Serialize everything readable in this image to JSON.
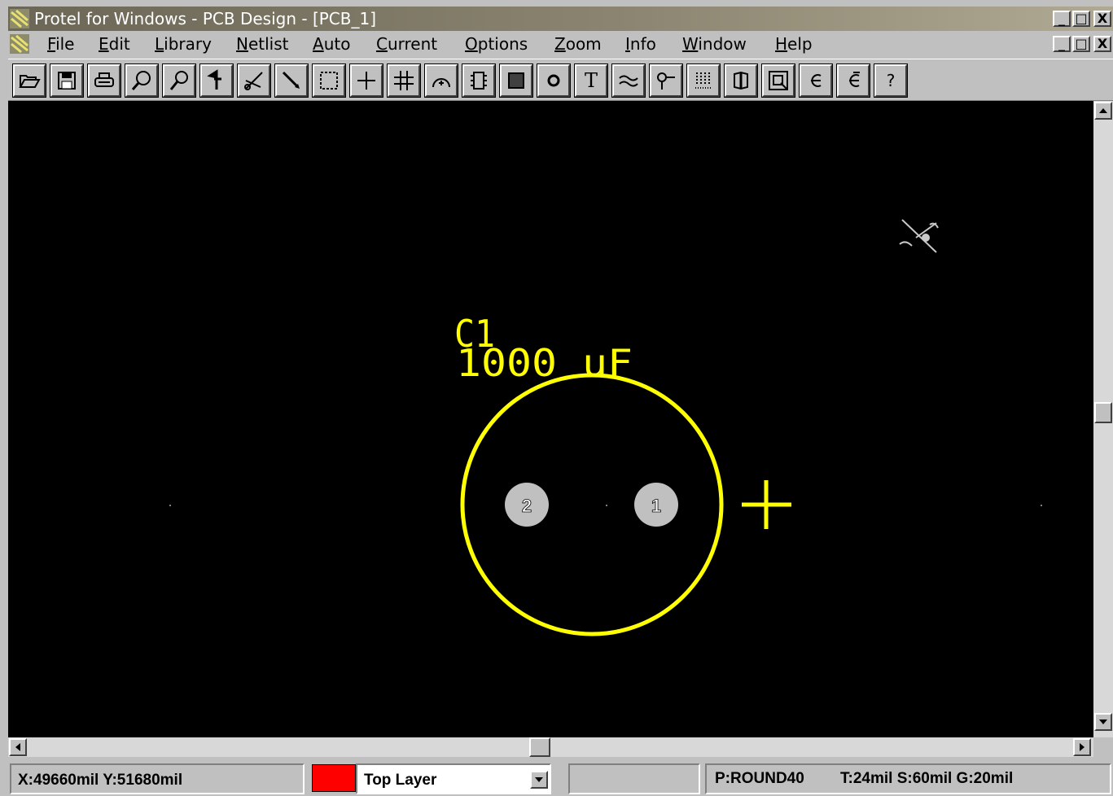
{
  "window": {
    "title": "Protel for Windows - PCB Design - [PCB_1]",
    "caption_buttons": [
      "_",
      "□",
      "X"
    ]
  },
  "menu": [
    "File",
    "Edit",
    "Library",
    "Netlist",
    "Auto",
    "Current",
    "Options",
    "Zoom",
    "Info",
    "Window",
    "Help"
  ],
  "toolbar": {
    "icons": [
      "open-icon",
      "save-icon",
      "print-icon",
      "zoom-in-icon",
      "zoom-out-icon",
      "pan-icon",
      "cut-icon",
      "route-icon",
      "select-icon",
      "move-icon",
      "grid-icon",
      "arc-icon",
      "component-icon",
      "fill-icon",
      "pad-icon",
      "text-icon",
      "track-icon",
      "via-icon",
      "connector-icon",
      "library-icon",
      "find-icon",
      "undo-icon",
      "redo-icon",
      "help-icon"
    ],
    "help_label": "?",
    "text_label": "T"
  },
  "pcb": {
    "designator": "C1",
    "comment": "1000 uF",
    "pads": [
      "2",
      "1"
    ],
    "colors": {
      "silkscreen": "#ffff00",
      "pad": "#c0c0c0",
      "background": "#000000"
    }
  },
  "status": {
    "coords": "X:49660mil Y:51680mil",
    "layer": "Top Layer",
    "layer_color": "#ff0000",
    "pad_shape": "P:ROUND40",
    "settings": "T:24mil S:60mil G:20mil"
  }
}
